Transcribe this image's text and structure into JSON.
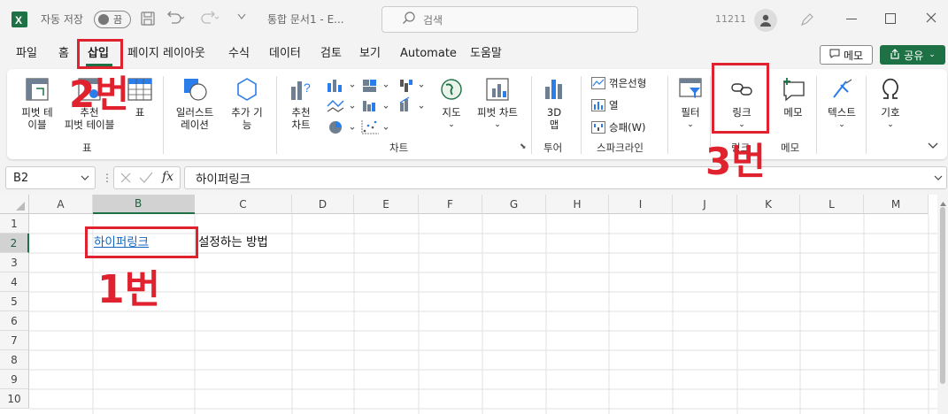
{
  "titlebar": {
    "autosave_label": "자동 저장",
    "autosave_toggle": "끔",
    "doc_title": "통합 문서1 - E...",
    "search_placeholder": "검색",
    "user_id": "11211"
  },
  "menu": {
    "tabs": [
      "파일",
      "홈",
      "삽입",
      "페이지 레이아웃",
      "수식",
      "데이터",
      "검토",
      "보기",
      "Automate",
      "도움말"
    ],
    "memo_btn": "메모",
    "share_btn": "공유"
  },
  "ribbon": {
    "pivot_table_1": "피벗 테",
    "pivot_table_2": "이블",
    "rec_pivot_1": "추천",
    "rec_pivot_2": "피벗 테이블",
    "table": "표",
    "group_table": "표",
    "illustrations_1": "일러스트",
    "illustrations_2": "레이션",
    "addins_1": "추가 기",
    "addins_2": "능",
    "rec_charts_1": "추천",
    "rec_charts_2": "차트",
    "maps": "지도",
    "pivot_chart": "피벗 차트",
    "group_charts": "차트",
    "map3d_1": "3D",
    "map3d_2": "맵",
    "group_tours": "투어",
    "spark_line": "꺾은선형",
    "spark_col": "열",
    "spark_winloss": "승패(W)",
    "group_sparklines": "스파크라인",
    "filter": "필터",
    "link": "링크",
    "group_link": "링크",
    "memo": "메모",
    "group_memo": "메모",
    "text": "텍스트",
    "symbol": "기호"
  },
  "formula_bar": {
    "name_box": "B2",
    "fx": "fx",
    "content": "하이퍼링크"
  },
  "sheet": {
    "columns": [
      "A",
      "B",
      "C",
      "D",
      "E",
      "F",
      "G",
      "H",
      "I",
      "J",
      "K",
      "L",
      "M"
    ],
    "rows": [
      "1",
      "2",
      "3",
      "4",
      "5",
      "6",
      "7",
      "8",
      "9",
      "10"
    ],
    "cell_B2": "하이퍼링크",
    "cell_C2": "설정하는 방법"
  },
  "annotations": {
    "step1": "1번",
    "step2": "2번",
    "step3": "3번"
  },
  "colors": {
    "accent_green": "#1e7145",
    "annotation_red": "#e0212e",
    "link_blue": "#1565c0"
  }
}
